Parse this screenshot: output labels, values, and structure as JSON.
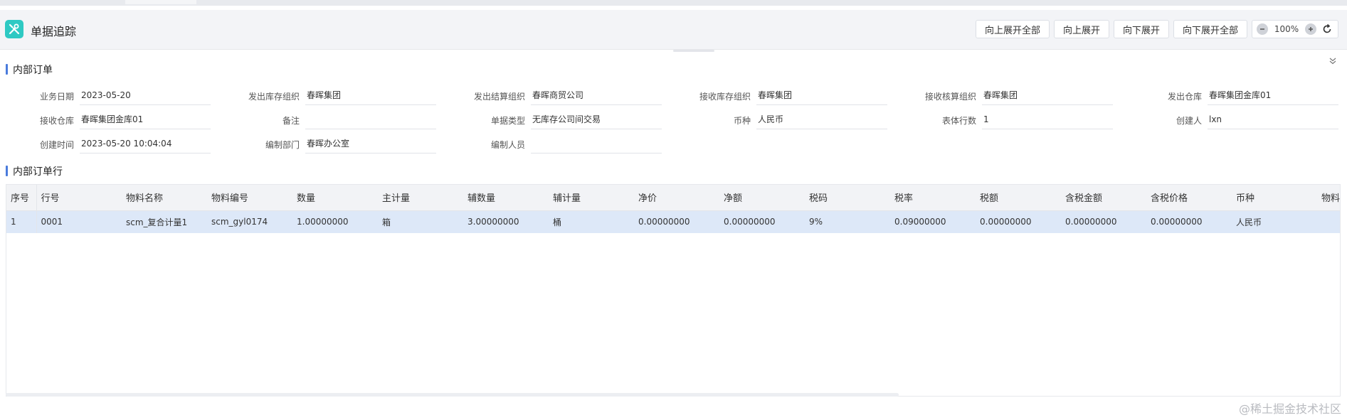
{
  "header": {
    "title": "单据追踪",
    "icon": "tools-icon",
    "accent_color": "#2ec9c3"
  },
  "toolbar": {
    "expand_up_all": "向上展开全部",
    "expand_up": "向上展开",
    "expand_down": "向下展开",
    "expand_down_all": "向下展开全部",
    "zoom_level": "100%"
  },
  "order_section": {
    "title": "内部订单",
    "fields": [
      [
        {
          "label": "业务日期",
          "value": "2023-05-20"
        },
        {
          "label": "发出库存组织",
          "value": "春晖集团"
        },
        {
          "label": "发出结算组织",
          "value": "春晖商贸公司"
        },
        {
          "label": "接收库存组织",
          "value": "春晖集团"
        },
        {
          "label": "接收核算组织",
          "value": "春晖集团"
        },
        {
          "label": "发出仓库",
          "value": "春晖集团金库01"
        }
      ],
      [
        {
          "label": "接收仓库",
          "value": "春晖集团金库01"
        },
        {
          "label": "备注",
          "value": ""
        },
        {
          "label": "单据类型",
          "value": "无库存公司间交易"
        },
        {
          "label": "币种",
          "value": "人民币"
        },
        {
          "label": "表体行数",
          "value": "1"
        },
        {
          "label": "创建人",
          "value": "lxn"
        }
      ],
      [
        {
          "label": "创建时间",
          "value": "2023-05-20 10:04:04"
        },
        {
          "label": "编制部门",
          "value": "春晖办公室"
        },
        {
          "label": "编制人员",
          "value": ""
        }
      ]
    ]
  },
  "lines_section": {
    "title": "内部订单行",
    "columns": [
      "序号",
      "行号",
      "物料名称",
      "物料编号",
      "数量",
      "主计量",
      "辅数量",
      "辅计量",
      "净价",
      "净额",
      "税码",
      "税率",
      "税额",
      "含税金额",
      "含税价格",
      "币种",
      "物料"
    ],
    "rows": [
      [
        "1",
        "0001",
        "scm_复合计量1",
        "scm_gyl0174",
        "1.00000000",
        "箱",
        "3.00000000",
        "桶",
        "0.00000000",
        "0.00000000",
        "9%",
        "0.09000000",
        "0.00000000",
        "0.00000000",
        "0.00000000",
        "人民币",
        ""
      ]
    ]
  },
  "watermark": "@稀土掘金技术社区"
}
